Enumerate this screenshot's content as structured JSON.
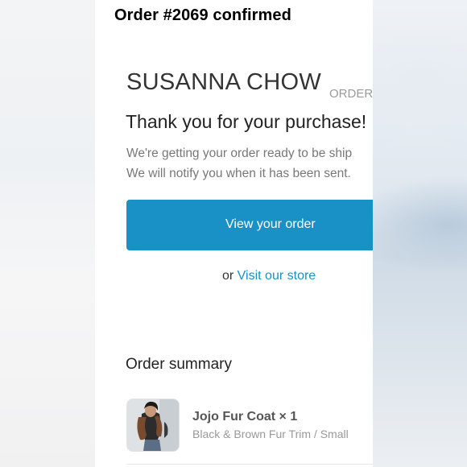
{
  "header": {
    "title": "Order #2069 confirmed"
  },
  "email": {
    "store_name": "SUSANNA CHOW",
    "order_label": "ORDER",
    "thank_you": "Thank you for your purchase!",
    "message_line1": "We're getting your order ready to be ship",
    "message_line2": "We will notify you when it has been sent.",
    "view_order_button": "View your order",
    "or_text": "or ",
    "visit_store_link": "Visit our store",
    "summary_title": "Order summary"
  },
  "order_items": [
    {
      "name": "Jojo Fur Coat × 1",
      "variant": "Black & Brown Fur Trim / Small",
      "thumbnail_icon": "product-photo"
    }
  ],
  "colors": {
    "accent": "#1990c6",
    "button_text": "#ffffff",
    "muted_text": "#777777"
  }
}
